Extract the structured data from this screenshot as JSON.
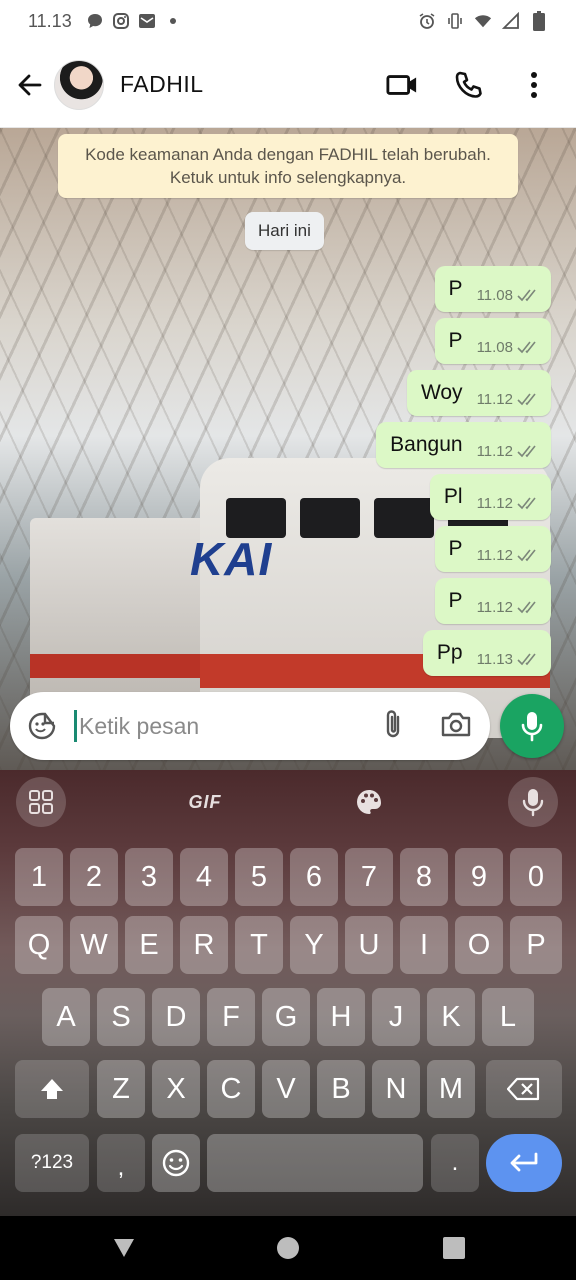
{
  "status_bar": {
    "time": "11.13",
    "left_icons": [
      "chat-bubble-icon",
      "instagram-icon",
      "mail-icon",
      "dot-icon"
    ],
    "right_icons": [
      "alarm-icon",
      "vibrate-icon",
      "wifi-icon",
      "signal-icon",
      "battery-icon"
    ]
  },
  "header": {
    "contact_name": "FADHIL",
    "actions": [
      "video-call-icon",
      "phone-icon",
      "more-vert-icon"
    ]
  },
  "chat": {
    "security_notice": "Kode keamanan Anda dengan FADHIL telah berubah. Ketuk untuk info selengkapnya.",
    "date_chip": "Hari ini",
    "wallpaper_logo": "KAI",
    "messages": [
      {
        "text": "P",
        "time": "11.08"
      },
      {
        "text": "P",
        "time": "11.08"
      },
      {
        "text": "Woy",
        "time": "11.12"
      },
      {
        "text": "Bangun",
        "time": "11.12"
      },
      {
        "text": "Pl",
        "time": "11.12"
      },
      {
        "text": "P",
        "time": "11.12"
      },
      {
        "text": "P",
        "time": "11.12"
      },
      {
        "text": "Pp",
        "time": "11.13"
      }
    ],
    "colors": {
      "outgoing_bubble": "#dcf8c6",
      "notice_bg": "#fdf2d0",
      "accent_green": "#1aa462"
    }
  },
  "composer": {
    "placeholder": "Ketik pesan"
  },
  "keyboard": {
    "toolbar": {
      "gif_label": "GIF"
    },
    "row_numbers": [
      "1",
      "2",
      "3",
      "4",
      "5",
      "6",
      "7",
      "8",
      "9",
      "0"
    ],
    "row1": [
      "Q",
      "W",
      "E",
      "R",
      "T",
      "Y",
      "U",
      "I",
      "O",
      "P"
    ],
    "row2": [
      "A",
      "S",
      "D",
      "F",
      "G",
      "H",
      "J",
      "K",
      "L"
    ],
    "row3": [
      "Z",
      "X",
      "C",
      "V",
      "B",
      "N",
      "M"
    ],
    "bottom": {
      "symbols": "?123",
      "comma": ",",
      "period": "."
    }
  }
}
